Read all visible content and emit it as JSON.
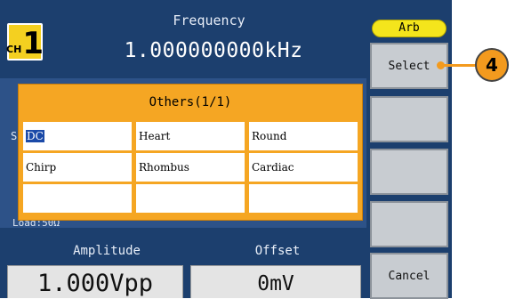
{
  "channel": {
    "prefix": "CH",
    "number": "1"
  },
  "frequency": {
    "label": "Frequency",
    "value": "1.000000000kHz"
  },
  "background": {
    "s_label": "S",
    "load_label": "Load:50Ω"
  },
  "popup": {
    "title": "Others(1/1)",
    "items": [
      {
        "label": "DC",
        "selected": true
      },
      {
        "label": "Heart"
      },
      {
        "label": "Round"
      },
      {
        "label": "Chirp"
      },
      {
        "label": "Rhombus"
      },
      {
        "label": "Cardiac"
      },
      {
        "label": ""
      },
      {
        "label": ""
      },
      {
        "label": ""
      }
    ]
  },
  "amplitude": {
    "label": "Amplitude",
    "value": "1.000Vpp"
  },
  "offset": {
    "label": "Offset",
    "value": "0mV"
  },
  "softkeys": {
    "tab": "Arb",
    "items": [
      "Select",
      "",
      "",
      "",
      "Cancel"
    ]
  },
  "callout": {
    "number": "4"
  },
  "colors": {
    "accent": "#f5a623",
    "screen": "#1c3f6e",
    "selection": "#1b4aa8"
  }
}
